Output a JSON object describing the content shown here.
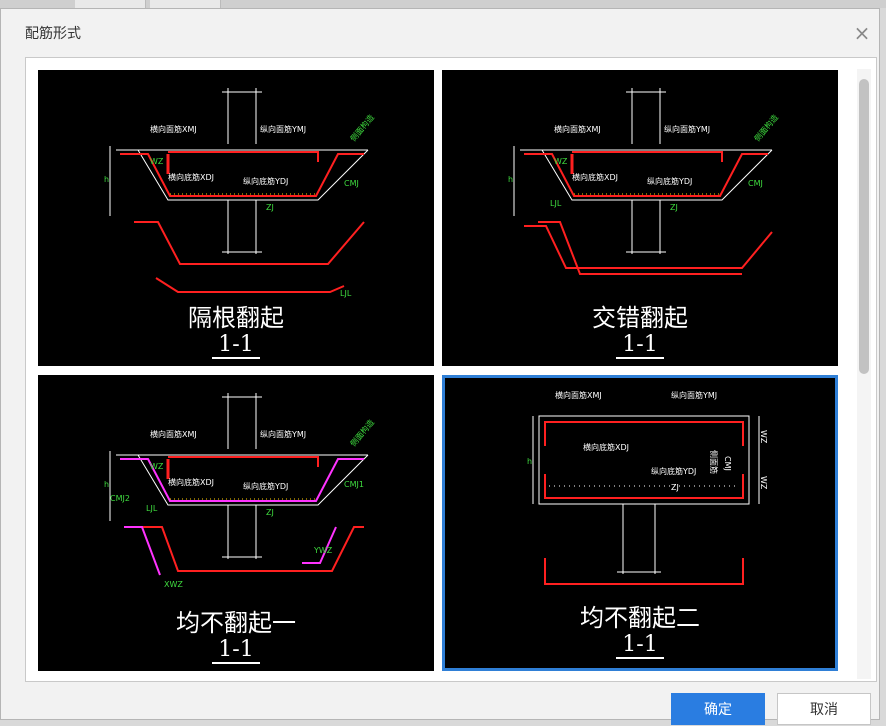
{
  "dialog": {
    "title": "配筋形式"
  },
  "options": [
    {
      "caption": "隔根翻起",
      "section": "1-1",
      "labels": {
        "top_x": "横向面筋XMJ",
        "top_y": "纵向面筋YMJ",
        "bot_x": "横向底筋XDJ",
        "bot_y": "纵向底筋YDJ",
        "side": "侧面构造",
        "cmj": "CMJ",
        "h": "h",
        "wz": "WZ",
        "zj": "ZJ",
        "ljl": "LJL"
      }
    },
    {
      "caption": "交错翻起",
      "section": "1-1",
      "labels": {
        "top_x": "横向面筋XMJ",
        "top_y": "纵向面筋YMJ",
        "bot_x": "横向底筋XDJ",
        "bot_y": "纵向底筋YDJ",
        "side": "侧面构造",
        "cmj": "CMJ",
        "h": "h",
        "wz": "WZ",
        "zj": "ZJ",
        "ljl": "LJL"
      }
    },
    {
      "caption": "均不翻起一",
      "section": "1-1",
      "labels": {
        "top_x": "横向面筋XMJ",
        "top_y": "纵向面筋YMJ",
        "bot_x": "横向底筋XDJ",
        "bot_y": "纵向底筋YDJ",
        "side": "侧面构造",
        "cmj1": "CMJ1",
        "cmj2": "CMJ2",
        "h": "h",
        "wz": "WZ",
        "zj": "ZJ",
        "xwz": "XWZ",
        "ywz": "YWZ",
        "ljl": "LJL"
      }
    },
    {
      "caption": "均不翻起二",
      "section": "1-1",
      "labels": {
        "top_x": "横向面筋XMJ",
        "top_y": "纵向面筋YMJ",
        "bot_x": "横向底筋XDJ",
        "bot_y": "纵向底筋YDJ",
        "side": "侧面筋",
        "cmj": "CMJ",
        "h": "h",
        "wz1": "WZ",
        "wz2": "WZ",
        "zj": "ZJ"
      }
    }
  ],
  "buttons": {
    "ok": "确定",
    "cancel": "取消"
  }
}
